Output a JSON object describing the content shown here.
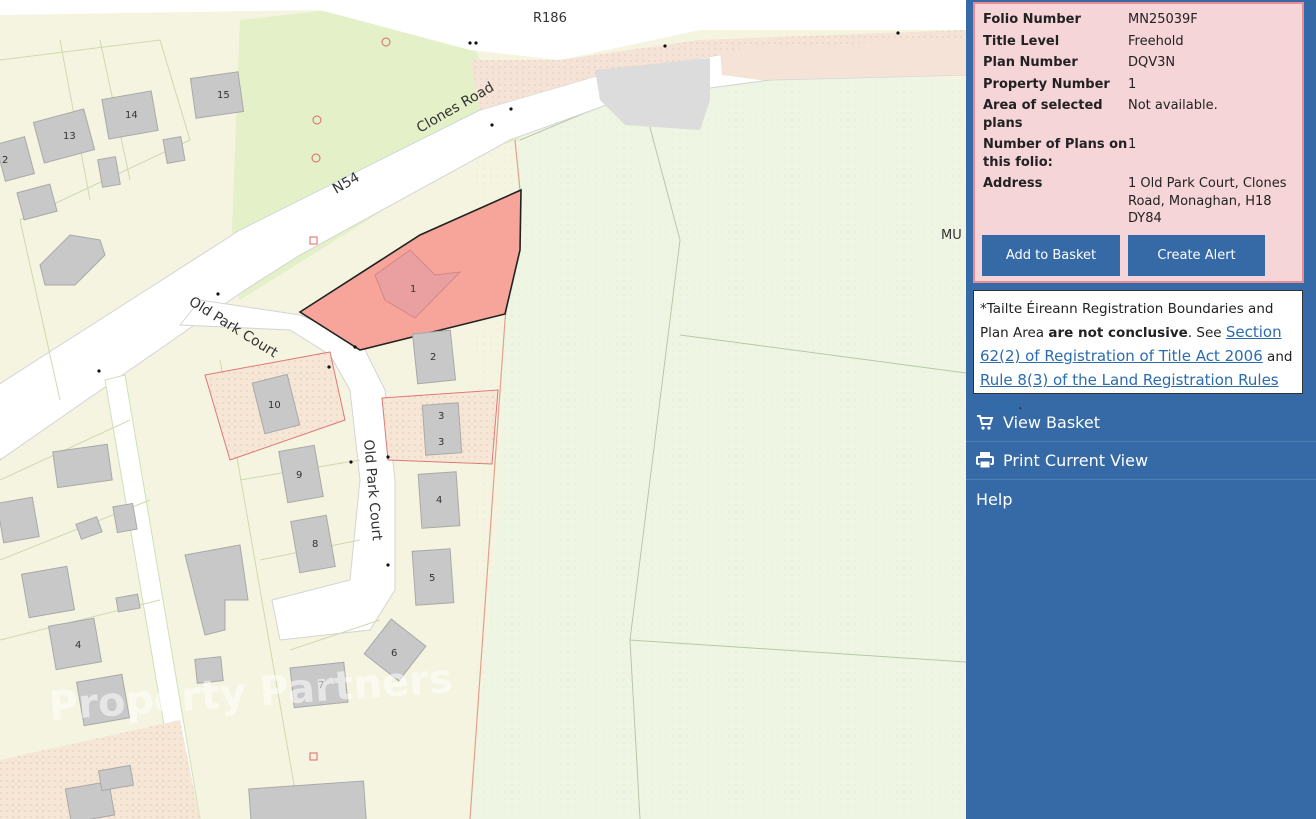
{
  "map": {
    "road_labels": {
      "r186": "R186",
      "clones_road": "Clones Road",
      "n54": "N54",
      "old_park_court_h": "Old Park Court",
      "old_park_court_v": "Old Park Court"
    },
    "house_numbers": [
      "15",
      "14",
      "13",
      "2",
      "1",
      "2",
      "3",
      "3",
      "10",
      "9",
      "4",
      "8",
      "5",
      "6",
      "7",
      "4"
    ],
    "partial_label": "MU",
    "watermark": "Property Partners",
    "colors": {
      "selected_parcel": "#f7a49a",
      "field": "#eef6e3",
      "lot": "#f7f5dc",
      "road": "#ffffff",
      "building": "#c8c8c8"
    }
  },
  "info": {
    "rows": [
      {
        "key": "Folio Number",
        "value": "MN25039F"
      },
      {
        "key": "Title Level",
        "value": "Freehold"
      },
      {
        "key": "Plan Number",
        "value": "DQV3N"
      },
      {
        "key": "Property Number",
        "value": "1"
      },
      {
        "key": "Area of selected plans",
        "value": "Not available."
      },
      {
        "key": "Number of Plans on this folio:",
        "value": "1"
      },
      {
        "key": "Address",
        "value": "1 Old Park Court, Clones Road, Monaghan, H18 DY84"
      }
    ],
    "add_to_basket": "Add to Basket",
    "create_alert": "Create Alert"
  },
  "disclaimer": {
    "prefix": "*Tailte Éireann Registration Boundaries and Plan Area ",
    "bold": "are not conclusive",
    "mid": ". See ",
    "link1": "Section 62(2) of Registration of Title Act 2006",
    "and": " and ",
    "link2": "Rule 8(3) of the Land Registration Rules 2012",
    "end": "."
  },
  "menu": {
    "view_basket": "View Basket",
    "print_current_view": "Print Current View",
    "help": "Help"
  },
  "icons": {
    "basket": "cart-icon",
    "print": "printer-icon"
  },
  "theme": {
    "sidebar": "#356aa6",
    "info_bg": "#f6d5d9",
    "info_border": "#e98a94"
  }
}
